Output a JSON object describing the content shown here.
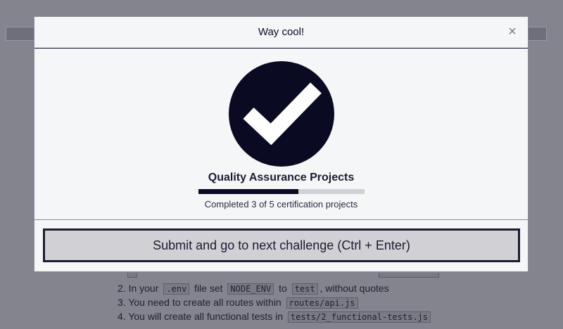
{
  "modal": {
    "title": "Way cool!",
    "close_label": "×",
    "badge_icon": "checkmark-icon",
    "certification_title": "Quality Assurance Projects",
    "progress": {
      "completed": 3,
      "total": 5,
      "text": "Completed 3 of 5 certification projects"
    },
    "submit_label": "Submit and go to next challenge (Ctrl + Enter)"
  },
  "background": {
    "instructions": [
      {
        "prefix": "2. In your ",
        "code1": ".env",
        "middle": " file set ",
        "code2": "NODE_ENV",
        "middle2": " to ",
        "code3": "test",
        "suffix": ", without quotes"
      },
      {
        "prefix": "3. You need to create all routes within ",
        "code1": "routes/api.js"
      },
      {
        "prefix": "4. You will create all functional tests in ",
        "code1": "tests/2_functional-tests.js"
      }
    ]
  },
  "colors": {
    "overlay": "#84848f",
    "modal_bg": "#f5f6f7",
    "accent_dark": "#0a0a23",
    "progress_track": "#d0d0d5"
  }
}
